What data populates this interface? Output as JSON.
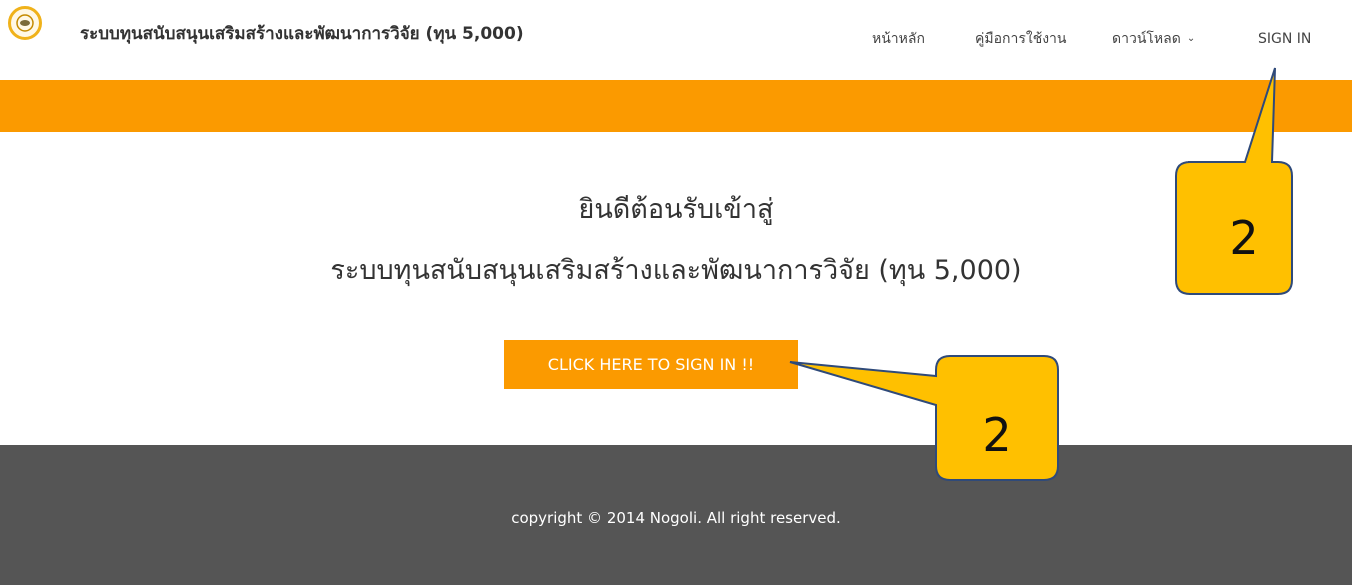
{
  "header": {
    "brand_title": "ระบบทุนสนับสนุนเสริมสร้างและพัฒนาการวิจัย (ทุน 5,000)",
    "nav": {
      "home": "หน้าหลัก",
      "manual": "คู่มือการใช้งาน",
      "download": "ดาวน์โหลด",
      "signin": "SIGN IN"
    }
  },
  "main": {
    "welcome_line1": "ยินดีต้อนรับเข้าสู่",
    "welcome_line2": "ระบบทุนสนับสนุนเสริมสร้างและพัฒนาการวิจัย (ทุน 5,000)",
    "cta_label": "CLICK HERE TO SIGN IN !!"
  },
  "footer": {
    "copyright": "copyright © 2014 Nogoli. All right reserved."
  },
  "annotations": {
    "callout_top": "2",
    "callout_bottom": "2"
  },
  "colors": {
    "accent_orange": "#fb9a00",
    "callout_fill": "#ffc000",
    "callout_border": "#2f4a7a",
    "footer_bg": "#555555"
  }
}
